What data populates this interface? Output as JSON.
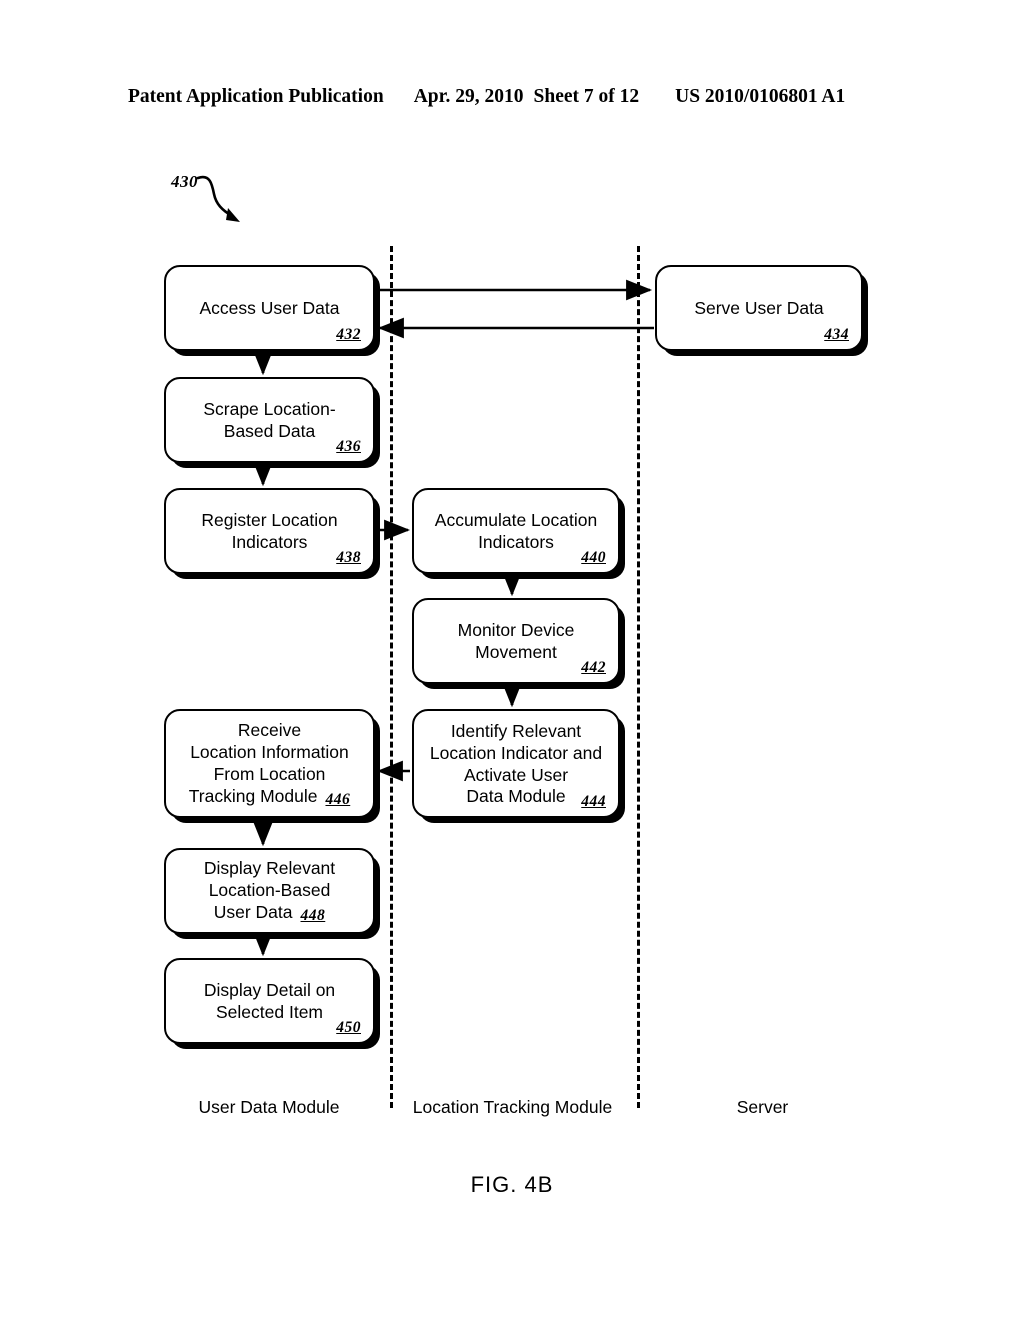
{
  "header": {
    "publication": "Patent Application Publication",
    "date": "Apr. 29, 2010",
    "sheet": "Sheet 7 of 12",
    "patent_number": "US 2010/0106801 A1"
  },
  "figure": {
    "caption": "FIG. 4B",
    "figure_reference": "430",
    "lanes": [
      {
        "id": "user-data-module",
        "label": "User Data Module"
      },
      {
        "id": "location-tracking-module",
        "label": "Location Tracking Module"
      },
      {
        "id": "server",
        "label": "Server"
      }
    ],
    "nodes": [
      {
        "id": "432",
        "lane": "user-data-module",
        "text": "Access User Data",
        "ref": "432",
        "ref_position": "corner"
      },
      {
        "id": "434",
        "lane": "server",
        "text": "Serve User Data",
        "ref": "434",
        "ref_position": "corner"
      },
      {
        "id": "436",
        "lane": "user-data-module",
        "text": "Scrape Location-\nBased Data",
        "ref": "436",
        "ref_position": "corner"
      },
      {
        "id": "438",
        "lane": "user-data-module",
        "text": "Register Location\nIndicators",
        "ref": "438",
        "ref_position": "corner"
      },
      {
        "id": "440",
        "lane": "location-tracking-module",
        "text": "Accumulate Location\nIndicators",
        "ref": "440",
        "ref_position": "corner"
      },
      {
        "id": "442",
        "lane": "location-tracking-module",
        "text": "Monitor Device\nMovement",
        "ref": "442",
        "ref_position": "corner"
      },
      {
        "id": "444",
        "lane": "location-tracking-module",
        "text": "Identify Relevant\nLocation Indicator and\nActivate User\nData Module",
        "ref": "444",
        "ref_position": "corner"
      },
      {
        "id": "446",
        "lane": "user-data-module",
        "text": "Receive\nLocation Information\nFrom Location\nTracking Module",
        "ref": "446",
        "ref_position": "inline"
      },
      {
        "id": "448",
        "lane": "user-data-module",
        "text": "Display Relevant\nLocation-Based\nUser Data",
        "ref": "448",
        "ref_position": "inline"
      },
      {
        "id": "450",
        "lane": "user-data-module",
        "text": "Display Detail on\nSelected Item",
        "ref": "450",
        "ref_position": "corner"
      }
    ],
    "edges": [
      {
        "from": "432",
        "to": "434",
        "direction": "right"
      },
      {
        "from": "434",
        "to": "432",
        "direction": "left"
      },
      {
        "from": "432",
        "to": "436",
        "direction": "down"
      },
      {
        "from": "436",
        "to": "438",
        "direction": "down"
      },
      {
        "from": "438",
        "to": "440",
        "direction": "right"
      },
      {
        "from": "440",
        "to": "442",
        "direction": "down"
      },
      {
        "from": "442",
        "to": "444",
        "direction": "down"
      },
      {
        "from": "444",
        "to": "446",
        "direction": "left"
      },
      {
        "from": "446",
        "to": "448",
        "direction": "down"
      },
      {
        "from": "448",
        "to": "450",
        "direction": "down"
      }
    ]
  }
}
